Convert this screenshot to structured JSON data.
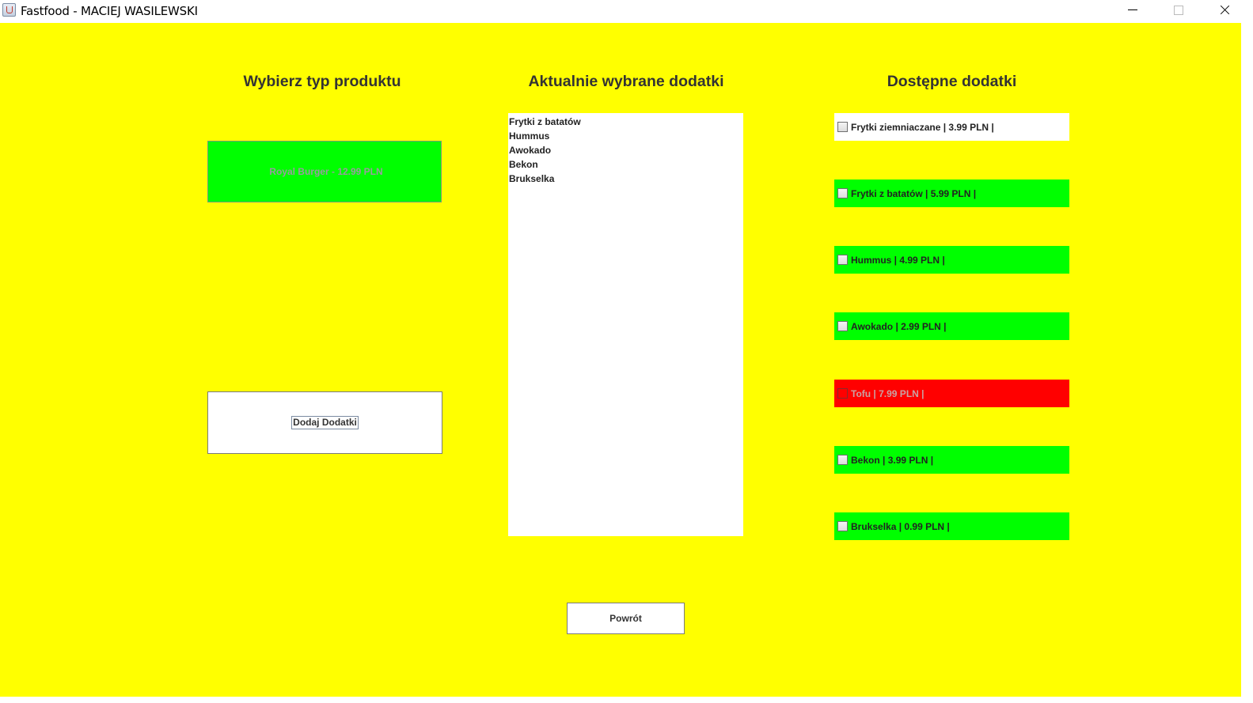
{
  "window": {
    "title": "Fastfood - MACIEJ WASILEWSKI",
    "controls": [
      "minimize-icon",
      "maximize-icon",
      "close-icon"
    ]
  },
  "colors": {
    "background": "#ffff00",
    "available": "#00ff00",
    "unavailable": "#ff0000",
    "neutral": "#ffffff"
  },
  "left_panel": {
    "heading": "Wybierz typ produktu",
    "product_button": "Royal Burger - 12.99 PLN",
    "add_button": "Dodaj Dodatki"
  },
  "middle_panel": {
    "heading": "Aktualnie wybrane dodatki",
    "selected_items": [
      "Frytki z batatów",
      "Hummus",
      "Awokado",
      "Bekon",
      "Brukselka"
    ]
  },
  "right_panel": {
    "heading": "Dostępne dodatki",
    "addons": [
      {
        "label": "Frytki ziemniaczane | 3.99 PLN |",
        "state": "white",
        "checked": false
      },
      {
        "label": "Frytki z batatów | 5.99 PLN |",
        "state": "green",
        "checked": false
      },
      {
        "label": "Hummus | 4.99 PLN |",
        "state": "green",
        "checked": false
      },
      {
        "label": "Awokado | 2.99 PLN |",
        "state": "green",
        "checked": false
      },
      {
        "label": "Tofu | 7.99 PLN |",
        "state": "red",
        "checked": false
      },
      {
        "label": "Bekon | 3.99 PLN |",
        "state": "green",
        "checked": false
      },
      {
        "label": "Brukselka | 0.99 PLN |",
        "state": "green",
        "checked": false
      }
    ]
  },
  "footer": {
    "back_button": "Powrót"
  }
}
